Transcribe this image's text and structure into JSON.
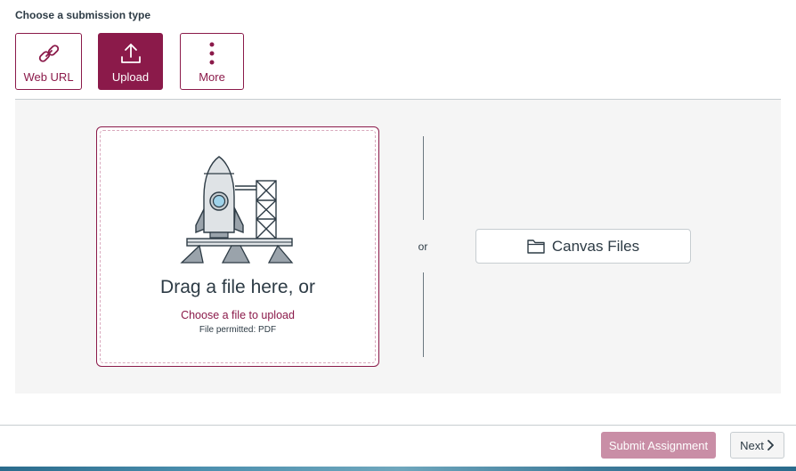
{
  "heading": "Choose a submission type",
  "submission_types": [
    {
      "label": "Web URL",
      "icon": "link-icon",
      "active": false
    },
    {
      "label": "Upload",
      "icon": "upload-icon",
      "active": true
    },
    {
      "label": "More",
      "icon": "more-vertical-icon",
      "active": false
    }
  ],
  "dropzone": {
    "title": "Drag a file here, or",
    "link": "Choose a file to upload",
    "permitted": "File permitted: PDF",
    "illustration": "rocket-launch-illustration"
  },
  "separator": "or",
  "canvas_files": {
    "label": "Canvas Files",
    "icon": "folder-icon"
  },
  "footer": {
    "submit_label": "Submit Assignment",
    "next_label": "Next"
  },
  "colors": {
    "accent": "#8b1a4a",
    "submit_disabled": "#c98ea6",
    "panel": "#f5f5f5"
  }
}
